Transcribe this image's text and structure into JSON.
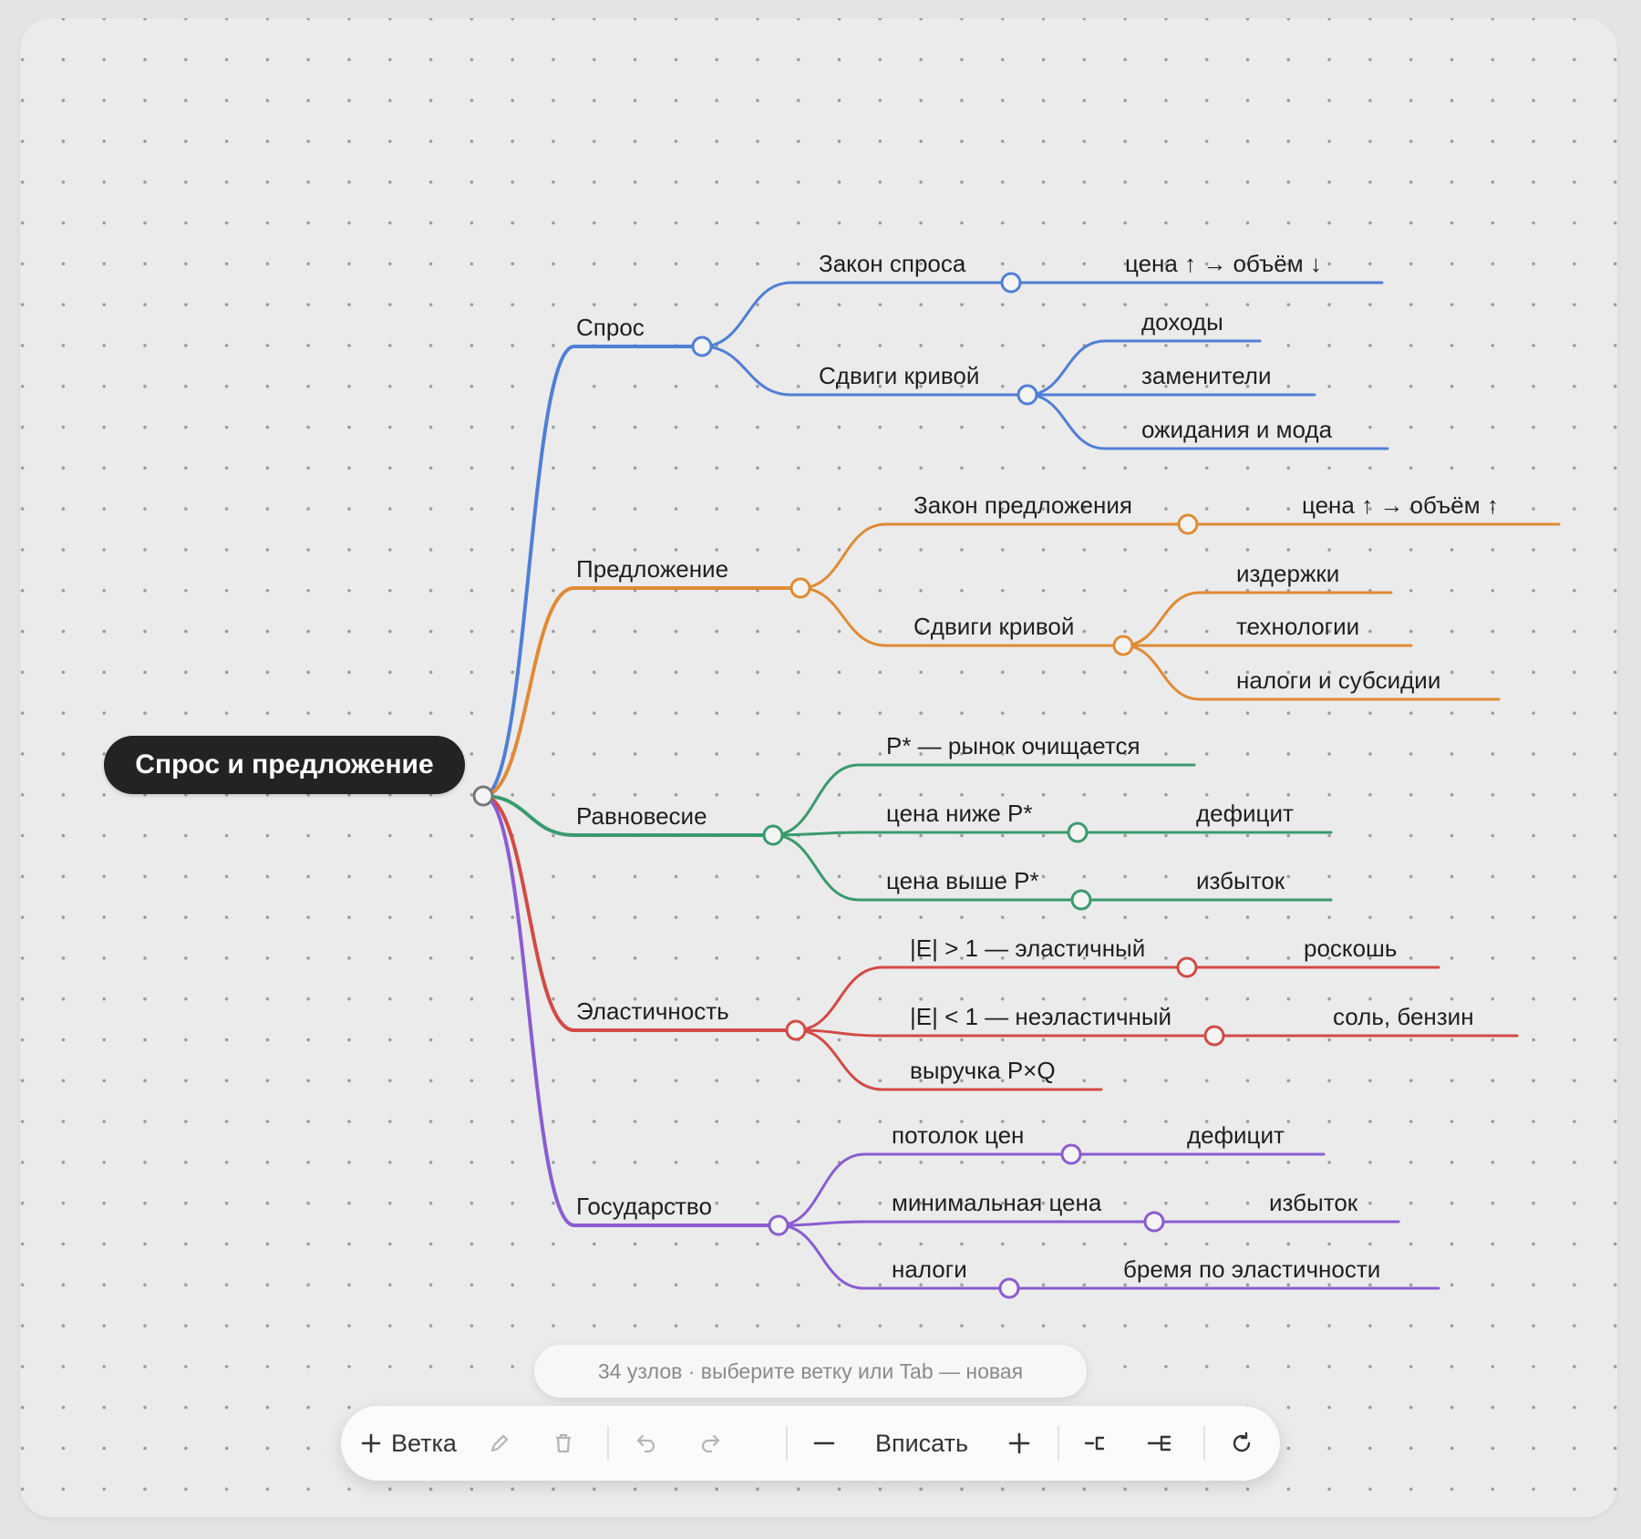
{
  "root": {
    "label": "Спрос и предложение"
  },
  "branches": [
    {
      "label": "Спрос",
      "color": "#4f7fd6",
      "children": [
        {
          "label": "Закон спроса",
          "children": [
            {
              "label": "цена ↑ → объём ↓"
            }
          ]
        },
        {
          "label": "Сдвиги кривой",
          "children": [
            {
              "label": "доходы"
            },
            {
              "label": "заменители"
            },
            {
              "label": "ожидания и мода"
            }
          ]
        }
      ]
    },
    {
      "label": "Предложение",
      "color": "#e08a35",
      "children": [
        {
          "label": "Закон предложения",
          "children": [
            {
              "label": "цена ↑ → объём ↑"
            }
          ]
        },
        {
          "label": "Сдвиги кривой",
          "children": [
            {
              "label": "издержки"
            },
            {
              "label": "технологии"
            },
            {
              "label": "налоги и субсидии"
            }
          ]
        }
      ]
    },
    {
      "label": "Равновесие",
      "color": "#3a9a6e",
      "children": [
        {
          "label": "P* — рынок очищается"
        },
        {
          "label": "цена ниже P*",
          "children": [
            {
              "label": "дефицит"
            }
          ]
        },
        {
          "label": "цена выше P*",
          "children": [
            {
              "label": "избыток"
            }
          ]
        }
      ]
    },
    {
      "label": "Эластичность",
      "color": "#d24b45",
      "children": [
        {
          "label": "|E| > 1 — эластичный",
          "children": [
            {
              "label": "роскошь"
            }
          ]
        },
        {
          "label": "|E| < 1 — неэластичный",
          "children": [
            {
              "label": "соль, бензин"
            }
          ]
        },
        {
          "label": "выручка P×Q"
        }
      ]
    },
    {
      "label": "Государство",
      "color": "#8a5cd0",
      "children": [
        {
          "label": "потолок цен",
          "children": [
            {
              "label": "дефицит"
            }
          ]
        },
        {
          "label": "минимальная цена",
          "children": [
            {
              "label": "избыток"
            }
          ]
        },
        {
          "label": "налоги",
          "children": [
            {
              "label": "бремя по эластичности"
            }
          ]
        }
      ]
    }
  ],
  "status": {
    "text": "34 узлов · выберите ветку или Tab — новая"
  },
  "toolbar": {
    "add_branch": "Ветка",
    "fit": "Вписать",
    "icons": [
      "plus-icon",
      "pencil-icon",
      "trash-icon",
      "undo-icon",
      "redo-icon",
      "minus-icon",
      "plus-icon",
      "collapse-icon",
      "expand-icon",
      "refresh-icon"
    ]
  }
}
